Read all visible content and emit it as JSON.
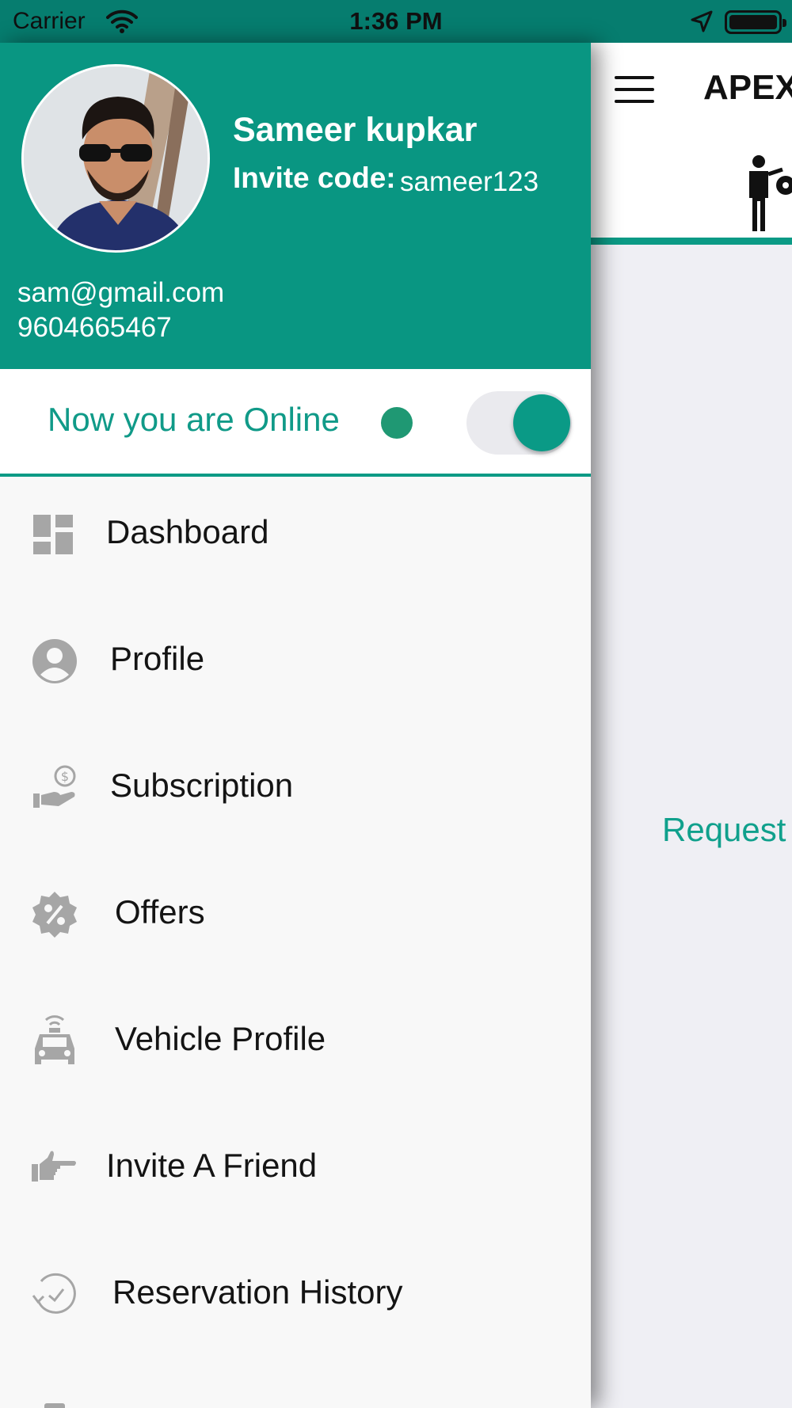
{
  "status_bar": {
    "carrier": "Carrier",
    "time": "1:36 PM",
    "wifi_icon": "wifi-icon",
    "location_icon": "location-arrow-icon",
    "battery_icon": "battery-full-icon"
  },
  "main": {
    "title": "APEX",
    "menu_icon": "hamburger-menu-icon",
    "header_icon": "person-with-car-icon",
    "request_text": "Request"
  },
  "drawer": {
    "user": {
      "name": "Sameer kupkar",
      "invite_label": "Invite code:",
      "invite_code": "sameer123",
      "email": "sam@gmail.com",
      "phone": "9604665467"
    },
    "online_status": {
      "text": "Now you are Online",
      "toggle_on": true
    },
    "menu": [
      {
        "label": "Dashboard",
        "icon": "dashboard-icon"
      },
      {
        "label": "Profile",
        "icon": "account-circle-icon"
      },
      {
        "label": "Subscription",
        "icon": "hand-dollar-icon"
      },
      {
        "label": "Offers",
        "icon": "discount-badge-icon"
      },
      {
        "label": "Vehicle Profile",
        "icon": "taxi-car-icon"
      },
      {
        "label": "Invite A Friend",
        "icon": "pointing-hand-icon"
      },
      {
        "label": "Reservation History",
        "icon": "history-clock-icon"
      }
    ]
  },
  "colors": {
    "primary": "#099682",
    "status_bar": "#067d6f",
    "online_dot": "#1f9873",
    "menu_icon_gray": "#a6a6a6"
  }
}
